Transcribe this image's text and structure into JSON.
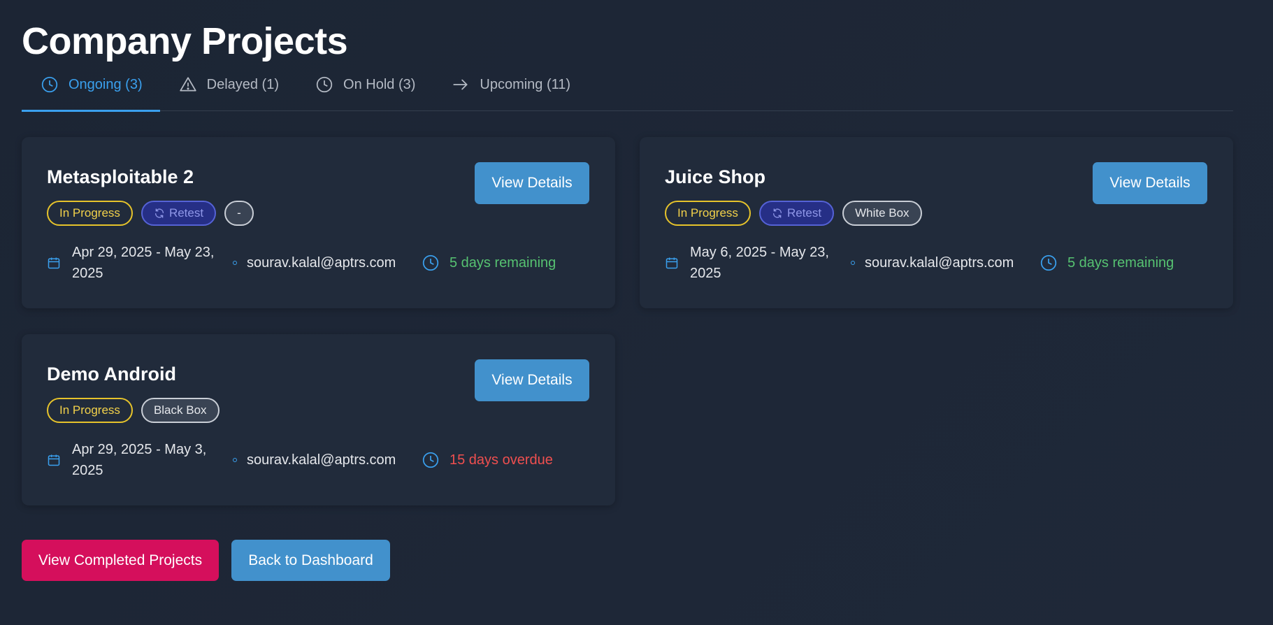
{
  "page": {
    "title": "Company Projects"
  },
  "tabs": [
    {
      "label": "Ongoing (3)",
      "icon": "clock-icon",
      "active": true
    },
    {
      "label": "Delayed (1)",
      "icon": "warning-icon",
      "active": false
    },
    {
      "label": "On Hold (3)",
      "icon": "clock-icon",
      "active": false
    },
    {
      "label": "Upcoming (11)",
      "icon": "arrow-right-icon",
      "active": false
    }
  ],
  "projects": [
    {
      "name": "Metasploitable 2",
      "button": "View Details",
      "status": "In Progress",
      "retest": "Retest",
      "type": "-",
      "dates": "Apr 29, 2025 - May 23, 2025",
      "owner": "sourav.kalal@aptrs.com",
      "remaining": "5 days remaining"
    },
    {
      "name": "Juice Shop",
      "button": "View Details",
      "status": "In Progress",
      "retest": "Retest",
      "type": "White Box",
      "dates": "May 6, 2025 - May 23, 2025",
      "owner": "sourav.kalal@aptrs.com",
      "remaining": "5 days remaining"
    },
    {
      "name": "Demo Android",
      "button": "View Details",
      "status": "In Progress",
      "type": "Black Box",
      "dates": "Apr 29, 2025 - May 3, 2025",
      "owner": "sourav.kalal@aptrs.com",
      "remaining": "15 days overdue"
    }
  ],
  "footer": {
    "completed_label": "View Completed Projects",
    "dashboard_label": "Back to Dashboard"
  },
  "colors": {
    "accent": "#3aa0ee",
    "button": "#4291cc",
    "completed_button": "#d50f5c",
    "status_in_progress": "#e6c32b",
    "remaining_ok": "#56c271",
    "overdue": "#ef4f4f"
  }
}
